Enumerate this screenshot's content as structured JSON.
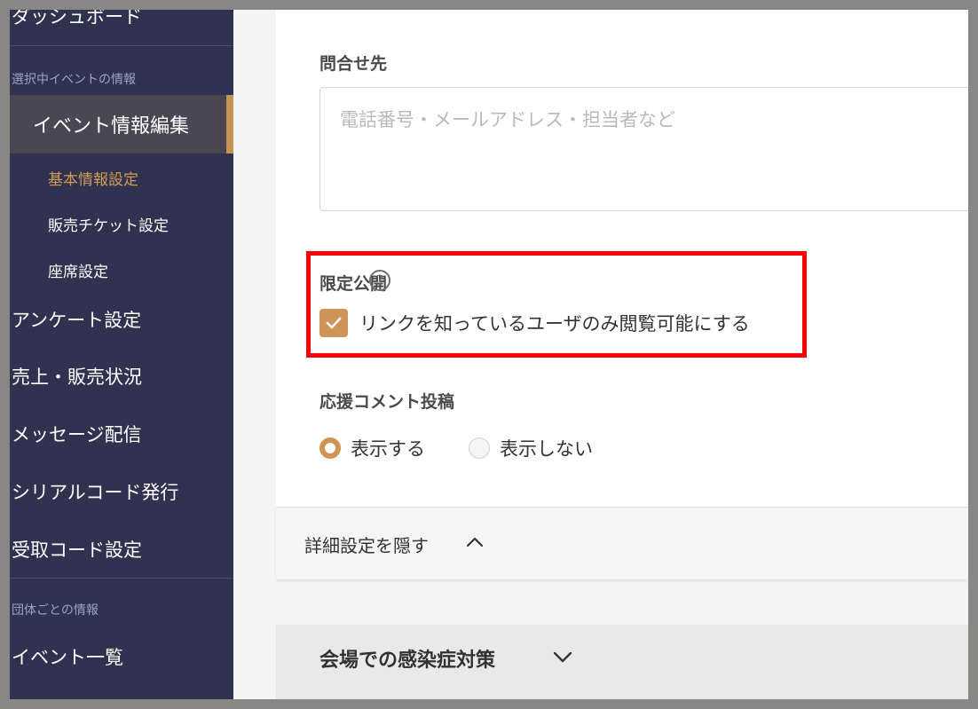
{
  "sidebar": {
    "dashboard_label": "ダッシュボード",
    "section_event": "選択中イベントの情報",
    "active_item": "イベント情報編集",
    "sub_items": [
      "基本情報設定",
      "販売チケット設定",
      "座席設定"
    ],
    "main_items": [
      "アンケート設定",
      "売上・販売状況",
      "メッセージ配信",
      "シリアルコード発行",
      "受取コード設定"
    ],
    "section_group": "団体ごとの情報",
    "event_list_label": "イベント一覧"
  },
  "form": {
    "contact_label": "問合せ先",
    "contact_placeholder": "電話番号・メールアドレス・担当者など",
    "contact_value": "",
    "limited_label": "限定公開",
    "help_glyph": "?",
    "limited_checkbox_label": "リンクを知っているユーザのみ閲覧可能にする",
    "limited_checked": true,
    "comment_label": "応援コメント投稿",
    "comment_options": [
      "表示する",
      "表示しない"
    ],
    "comment_selected": "表示する"
  },
  "detail_toggle": {
    "label": "詳細設定を隠す",
    "icon": "chevron-up-icon"
  },
  "infection_panel": {
    "title": "会場での感染症対策",
    "icon": "chevron-down-icon"
  },
  "colors": {
    "sidebar_bg": "#2f3350",
    "accent": "#cf9356",
    "active_sub": "#d59a55",
    "highlight": "#ff0000"
  }
}
